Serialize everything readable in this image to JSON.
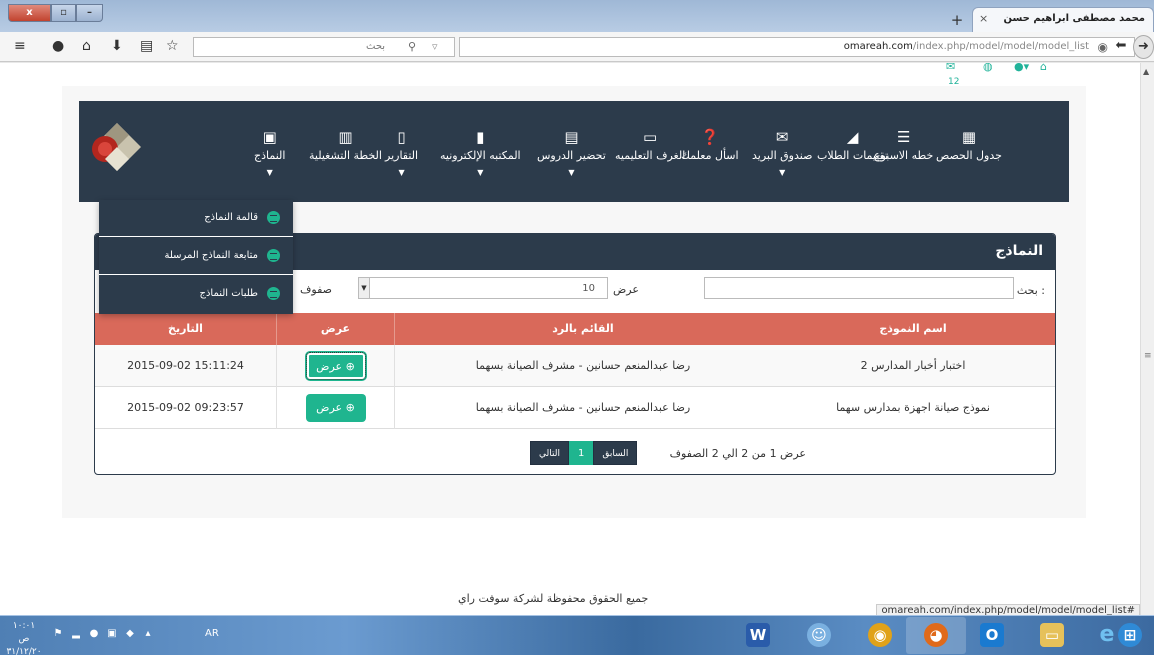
{
  "browser": {
    "tab_title": "محمد مصطفى ابراهيم حسن",
    "tab_close": "×",
    "new_tab": "+",
    "search_placeholder": "بحث",
    "url_prefix": "omareah.com",
    "url_rest": "/index.php/model/model/model_list",
    "status_url": "omareah.com/index.php/model/model/model_list#",
    "win_close": "x",
    "win_max": "▫",
    "win_min": "–"
  },
  "top_bar": {
    "mail_count": "12"
  },
  "nav": {
    "items": [
      {
        "label": "جدول الحصص",
        "icon": "table-icon",
        "glyph": "▦",
        "caret": false
      },
      {
        "label": "خطه الاسبوع",
        "icon": "list-icon",
        "glyph": "☰",
        "caret": false
      },
      {
        "label": "تقييمات الطلاب",
        "icon": "area-chart-icon",
        "glyph": "◢",
        "caret": false
      },
      {
        "label": "صندوق البريد",
        "icon": "envelope-icon",
        "glyph": "✉",
        "caret": true
      },
      {
        "label": "اسأل معلمك",
        "icon": "question-icon",
        "glyph": "❓",
        "caret": false
      },
      {
        "label": "الغرف التعليميه",
        "icon": "monitor-icon",
        "glyph": "▭",
        "caret": false
      },
      {
        "label": "تحضير الدروس",
        "icon": "list-alt-icon",
        "glyph": "▤",
        "caret": true
      },
      {
        "label": "المكتبه الإلكترونيه",
        "icon": "book-icon",
        "glyph": "▮",
        "caret": true
      },
      {
        "label": "التقارير",
        "icon": "file-icon",
        "glyph": "▯",
        "caret": true
      },
      {
        "label": "الخطة التشغيلية",
        "icon": "bar-chart-icon",
        "glyph": "▥",
        "caret": false
      },
      {
        "label": "النماذج",
        "icon": "th-large-icon",
        "glyph": "▣",
        "caret": true
      }
    ],
    "caret_glyph": "▼"
  },
  "dropdown": {
    "items": [
      {
        "label": "قالمة النماذج"
      },
      {
        "label": "متابعة النماذج المرسلة"
      },
      {
        "label": "طلبات النماذج"
      }
    ]
  },
  "panel": {
    "title": "النماذج",
    "search_label": "بحث :",
    "show_label": "عرض",
    "length_value": "10",
    "rows_label": "صفوف",
    "columns": [
      "اسم النموذج",
      "القائم بالرد",
      "عرض",
      "التاريخ"
    ],
    "rows": [
      {
        "name": "اختبار أخبار المدارس 2",
        "responder": "رضا عبدالمنعم حسانين - مشرف الصيانة بسهما",
        "action": "عرض",
        "date": "2015-09-02 15:11:24"
      },
      {
        "name": "نموذج صيانة اجهزة بمدارس سهما",
        "responder": "رضا عبدالمنعم حسانين - مشرف الصيانة بسهما",
        "action": "عرض",
        "date": "2015-09-02 09:23:57"
      }
    ],
    "info": "عرض 1 من 2 الي 2 الصفوف",
    "pager": {
      "prev": "السابق",
      "current": "1",
      "next": "التالي"
    }
  },
  "footer": {
    "text": "جميع الحقوق محفوظة لشركة سوفت راي"
  },
  "taskbar": {
    "time": "١٠:٠١ ص",
    "date": "٣١/١٢/٢٠",
    "lang": "AR"
  },
  "colors": {
    "nav_bg": "#2c3b4b",
    "table_header": "#d9695a",
    "accent": "#1fb58f"
  }
}
